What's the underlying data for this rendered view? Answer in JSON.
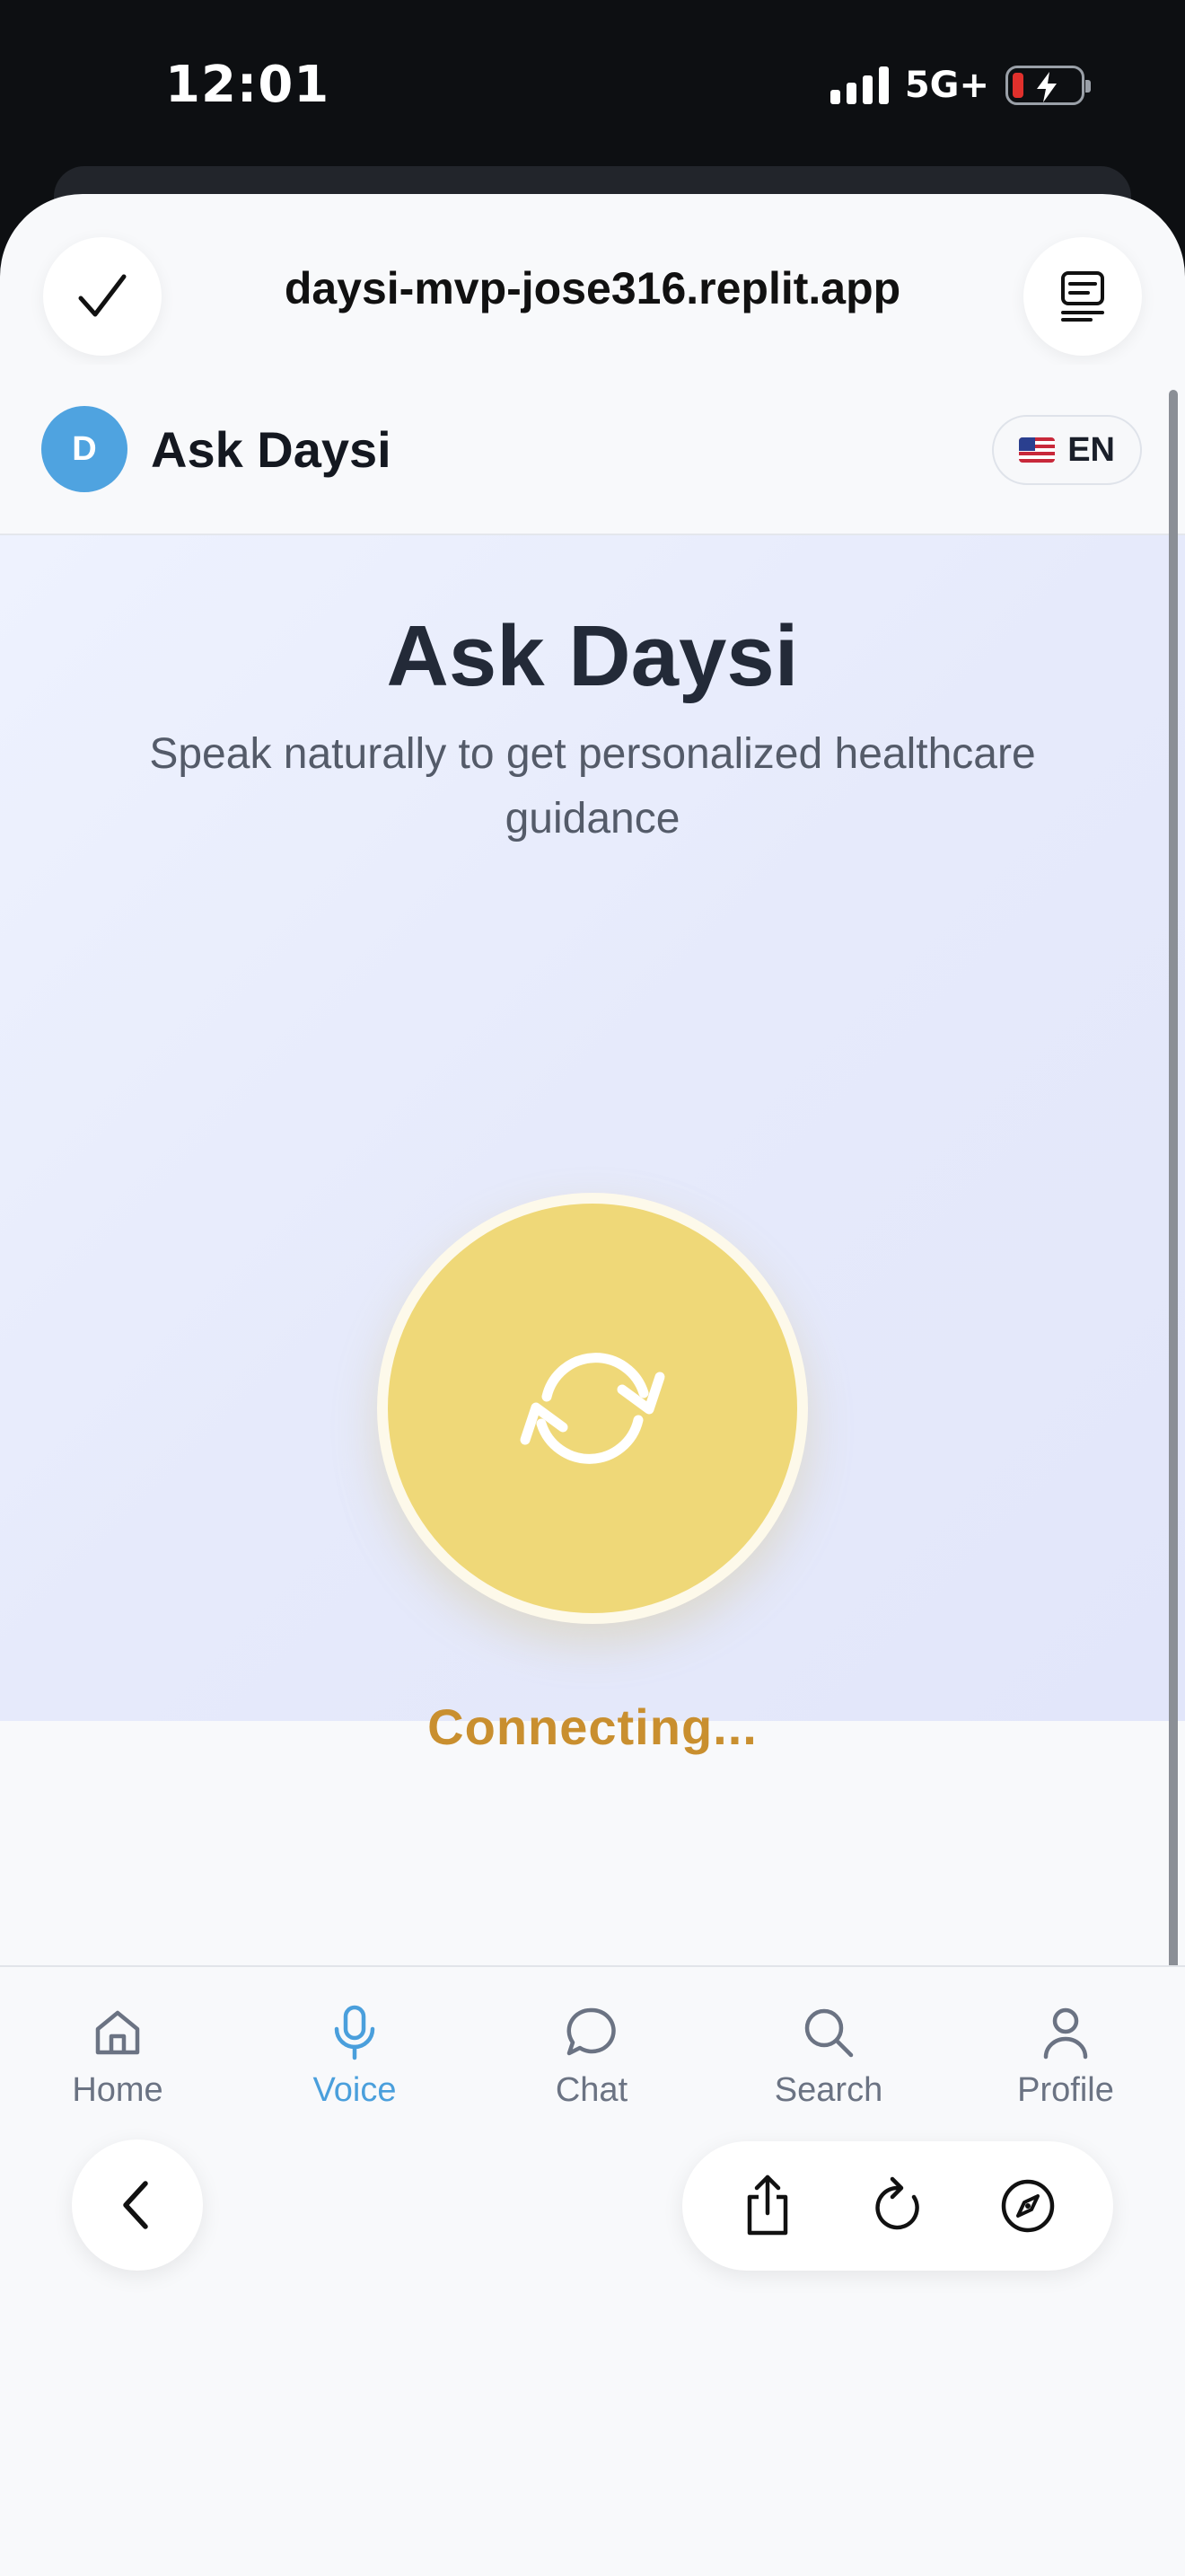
{
  "status_bar": {
    "time": "12:01",
    "network": "5G+",
    "signal_bars": 4,
    "battery_level": 0.1,
    "battery_charging": true
  },
  "browser": {
    "url": "daysi-mvp-jose316.replit.app",
    "done_icon": "checkmark-icon",
    "tabs_icon": "tabs-overview-icon"
  },
  "app_header": {
    "avatar_letter": "D",
    "title": "Ask Daysi",
    "language": {
      "flag": "us-flag-icon",
      "code": "EN"
    }
  },
  "hero": {
    "title": "Ask Daysi",
    "subtitle": "Speak naturally to get personalized healthcare guidance",
    "voice_button_icon": "refresh-sync-icon",
    "status": "Connecting...",
    "accent_color": "#efd878",
    "status_color": "#c98f2f"
  },
  "nav": {
    "items": [
      {
        "label": "Home",
        "icon": "home-icon",
        "active": false
      },
      {
        "label": "Voice",
        "icon": "microphone-icon",
        "active": true
      },
      {
        "label": "Chat",
        "icon": "chat-bubble-icon",
        "active": false
      },
      {
        "label": "Search",
        "icon": "search-icon",
        "active": false
      },
      {
        "label": "Profile",
        "icon": "user-icon",
        "active": false
      }
    ],
    "active_color": "#4a9fdc"
  },
  "safari_toolbar": {
    "back_icon": "chevron-left-icon",
    "share_icon": "share-icon",
    "reload_icon": "reload-icon",
    "compass_icon": "compass-icon"
  }
}
